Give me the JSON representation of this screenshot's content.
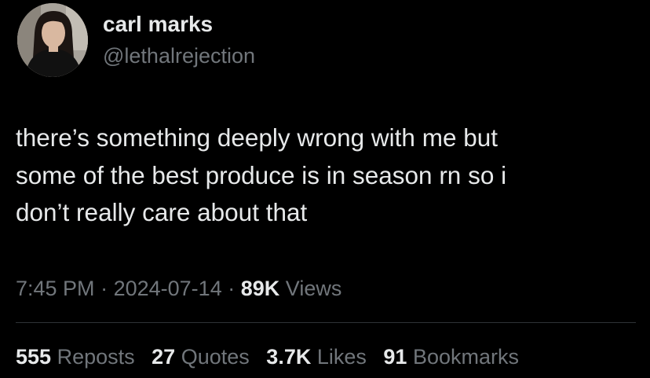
{
  "author": {
    "name": "carl marks",
    "handle": "@lethalrejection"
  },
  "tweet": {
    "lines": [
      "there’s something deeply wrong with me but",
      "some of the best produce is in season rn so i",
      "don’t really care about that"
    ],
    "time": "7:45 PM",
    "separator": "·",
    "date": "2024-07-14",
    "views_count": "89K",
    "views_label": "Views"
  },
  "stats": {
    "reposts": {
      "count": "555",
      "label": "Reposts"
    },
    "quotes": {
      "count": "27",
      "label": "Quotes"
    },
    "likes": {
      "count": "3.7K",
      "label": "Likes"
    },
    "bookmarks": {
      "count": "91",
      "label": "Bookmarks"
    }
  },
  "colors": {
    "background": "#000000",
    "primary_text": "#e7e9ea",
    "secondary_text": "#71767b",
    "divider": "#2f3336"
  }
}
